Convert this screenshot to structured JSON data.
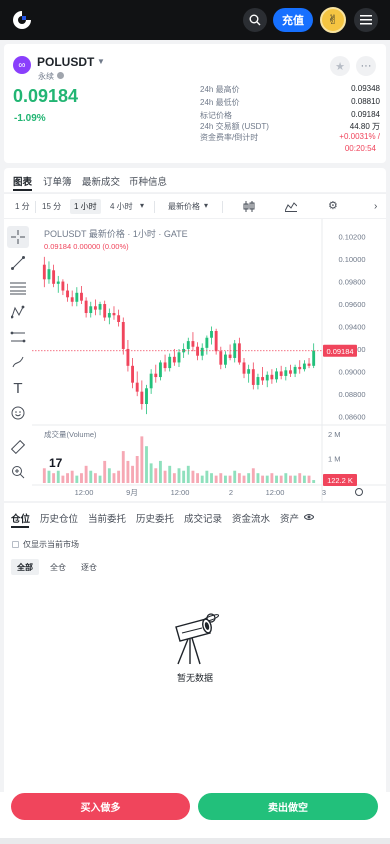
{
  "topbar": {
    "deposit_label": "充值",
    "icons": [
      "logo-icon",
      "search-icon",
      "avatar",
      "menu-icon"
    ]
  },
  "ticker": {
    "symbol": "POLUSDT",
    "type": "永续",
    "price": "0.09184",
    "change": "-1.09%",
    "stats": [
      {
        "label": "24h 最高价",
        "value": "0.09348"
      },
      {
        "label": "24h 最低价",
        "value": "0.08810"
      },
      {
        "label": "标记价格",
        "value": "0.09184"
      },
      {
        "label": "24h 交易额 (USDT)",
        "value": "44.80 万"
      },
      {
        "label": "资金费率/倒计时",
        "value": "+0.0031% /"
      }
    ],
    "countdown": "00:20:54"
  },
  "tabs": [
    "图表",
    "订单簿",
    "最新成交",
    "币种信息"
  ],
  "timeframes": {
    "items": [
      "1 分",
      "15 分",
      "1 小时",
      "4 小时"
    ],
    "active": "1 小时",
    "price_type": "最新价格"
  },
  "chart": {
    "title": "POLUSDT 最新价格 · 1小时 · GATE",
    "ohlc": "0.09184  0.00000 (0.00%)",
    "volume_label": "成交量(Volume)",
    "current_price_tag": "0.09184",
    "volume_tag": "122.2 K",
    "colors": {
      "up": "#22c07b",
      "down": "#f0455c"
    }
  },
  "chart_data": {
    "type": "candlestick",
    "title": "POLUSDT 最新价格 · 1小时 · GATE",
    "yticks": [
      "0.10200",
      "0.10000",
      "0.09800",
      "0.09600",
      "0.09400",
      "0.09200",
      "0.09000",
      "0.08800",
      "0.08600"
    ],
    "ylim": [
      0.0855,
      0.1025
    ],
    "volume_yticks": [
      "2 M",
      "1 M"
    ],
    "xticks": [
      "12:00",
      "9月",
      "12:00",
      "2",
      "12:00",
      "3"
    ],
    "current_price": 0.09184,
    "last_volume": "122.2 K",
    "candles": [
      {
        "o": 0.0995,
        "h": 0.1002,
        "l": 0.0975,
        "c": 0.0982
      },
      {
        "o": 0.0982,
        "h": 0.0998,
        "l": 0.0978,
        "c": 0.0991
      },
      {
        "o": 0.099,
        "h": 0.0995,
        "l": 0.0975,
        "c": 0.0978
      },
      {
        "o": 0.0978,
        "h": 0.0985,
        "l": 0.097,
        "c": 0.098
      },
      {
        "o": 0.098,
        "h": 0.0982,
        "l": 0.0968,
        "c": 0.0972
      },
      {
        "o": 0.0972,
        "h": 0.0978,
        "l": 0.0962,
        "c": 0.0966
      },
      {
        "o": 0.0966,
        "h": 0.0972,
        "l": 0.0958,
        "c": 0.0962
      },
      {
        "o": 0.0962,
        "h": 0.0975,
        "l": 0.0958,
        "c": 0.097
      },
      {
        "o": 0.097,
        "h": 0.0976,
        "l": 0.096,
        "c": 0.0963
      },
      {
        "o": 0.0963,
        "h": 0.0966,
        "l": 0.0948,
        "c": 0.0952
      },
      {
        "o": 0.0952,
        "h": 0.0962,
        "l": 0.0948,
        "c": 0.0958
      },
      {
        "o": 0.0958,
        "h": 0.0964,
        "l": 0.095,
        "c": 0.0955
      },
      {
        "o": 0.0955,
        "h": 0.0962,
        "l": 0.095,
        "c": 0.096
      },
      {
        "o": 0.096,
        "h": 0.0963,
        "l": 0.0945,
        "c": 0.0948
      },
      {
        "o": 0.0948,
        "h": 0.0956,
        "l": 0.0942,
        "c": 0.0952
      },
      {
        "o": 0.0952,
        "h": 0.0958,
        "l": 0.0946,
        "c": 0.095
      },
      {
        "o": 0.095,
        "h": 0.0955,
        "l": 0.094,
        "c": 0.0944
      },
      {
        "o": 0.0944,
        "h": 0.0948,
        "l": 0.0915,
        "c": 0.092
      },
      {
        "o": 0.092,
        "h": 0.0928,
        "l": 0.09,
        "c": 0.0905
      },
      {
        "o": 0.0905,
        "h": 0.0912,
        "l": 0.0885,
        "c": 0.089
      },
      {
        "o": 0.089,
        "h": 0.09,
        "l": 0.0878,
        "c": 0.0882
      },
      {
        "o": 0.0882,
        "h": 0.0892,
        "l": 0.0866,
        "c": 0.0871
      },
      {
        "o": 0.0871,
        "h": 0.0888,
        "l": 0.0862,
        "c": 0.0885
      },
      {
        "o": 0.0885,
        "h": 0.0902,
        "l": 0.088,
        "c": 0.0898
      },
      {
        "o": 0.0898,
        "h": 0.0906,
        "l": 0.089,
        "c": 0.0895
      },
      {
        "o": 0.0895,
        "h": 0.091,
        "l": 0.0892,
        "c": 0.0908
      },
      {
        "o": 0.0908,
        "h": 0.0915,
        "l": 0.09,
        "c": 0.0903
      },
      {
        "o": 0.0903,
        "h": 0.0916,
        "l": 0.09,
        "c": 0.0913
      },
      {
        "o": 0.0913,
        "h": 0.092,
        "l": 0.0905,
        "c": 0.0908
      },
      {
        "o": 0.0908,
        "h": 0.092,
        "l": 0.0904,
        "c": 0.0917
      },
      {
        "o": 0.0917,
        "h": 0.0925,
        "l": 0.0912,
        "c": 0.092
      },
      {
        "o": 0.092,
        "h": 0.093,
        "l": 0.0915,
        "c": 0.0927
      },
      {
        "o": 0.0927,
        "h": 0.0935,
        "l": 0.0918,
        "c": 0.0922
      },
      {
        "o": 0.0922,
        "h": 0.0926,
        "l": 0.091,
        "c": 0.0914
      },
      {
        "o": 0.0914,
        "h": 0.0925,
        "l": 0.091,
        "c": 0.0921
      },
      {
        "o": 0.0921,
        "h": 0.0932,
        "l": 0.0915,
        "c": 0.093
      },
      {
        "o": 0.093,
        "h": 0.094,
        "l": 0.0924,
        "c": 0.0936
      },
      {
        "o": 0.0936,
        "h": 0.0938,
        "l": 0.0915,
        "c": 0.0918
      },
      {
        "o": 0.0918,
        "h": 0.0922,
        "l": 0.0902,
        "c": 0.0906
      },
      {
        "o": 0.0906,
        "h": 0.0918,
        "l": 0.0903,
        "c": 0.0915
      },
      {
        "o": 0.0915,
        "h": 0.0924,
        "l": 0.091,
        "c": 0.0912
      },
      {
        "o": 0.0912,
        "h": 0.0928,
        "l": 0.0908,
        "c": 0.0925
      },
      {
        "o": 0.0925,
        "h": 0.093,
        "l": 0.0906,
        "c": 0.0908
      },
      {
        "o": 0.0908,
        "h": 0.0912,
        "l": 0.0894,
        "c": 0.0898
      },
      {
        "o": 0.0898,
        "h": 0.0906,
        "l": 0.089,
        "c": 0.0902
      },
      {
        "o": 0.0902,
        "h": 0.0908,
        "l": 0.0884,
        "c": 0.0888
      },
      {
        "o": 0.0888,
        "h": 0.0898,
        "l": 0.0884,
        "c": 0.0895
      },
      {
        "o": 0.0895,
        "h": 0.0904,
        "l": 0.0888,
        "c": 0.0892
      },
      {
        "o": 0.0892,
        "h": 0.09,
        "l": 0.0886,
        "c": 0.0897
      },
      {
        "o": 0.0897,
        "h": 0.0902,
        "l": 0.0889,
        "c": 0.0893
      },
      {
        "o": 0.0893,
        "h": 0.0903,
        "l": 0.089,
        "c": 0.09
      },
      {
        "o": 0.09,
        "h": 0.0905,
        "l": 0.0893,
        "c": 0.0896
      },
      {
        "o": 0.0896,
        "h": 0.0904,
        "l": 0.0892,
        "c": 0.0901
      },
      {
        "o": 0.0901,
        "h": 0.0906,
        "l": 0.0895,
        "c": 0.0898
      },
      {
        "o": 0.0898,
        "h": 0.0906,
        "l": 0.0895,
        "c": 0.0904
      },
      {
        "o": 0.0904,
        "h": 0.091,
        "l": 0.0898,
        "c": 0.0902
      },
      {
        "o": 0.0902,
        "h": 0.091,
        "l": 0.09,
        "c": 0.0907
      },
      {
        "o": 0.0907,
        "h": 0.0912,
        "l": 0.0903,
        "c": 0.0905
      },
      {
        "o": 0.0905,
        "h": 0.0925,
        "l": 0.0903,
        "c": 0.09184
      }
    ],
    "volumes": [
      0.6,
      0.5,
      0.4,
      0.5,
      0.3,
      0.4,
      0.5,
      0.3,
      0.4,
      0.7,
      0.5,
      0.4,
      0.3,
      0.9,
      0.6,
      0.4,
      0.5,
      1.3,
      0.9,
      0.7,
      1.1,
      1.9,
      1.5,
      0.8,
      0.6,
      0.9,
      0.5,
      0.7,
      0.4,
      0.6,
      0.5,
      0.7,
      0.5,
      0.4,
      0.3,
      0.5,
      0.4,
      0.3,
      0.4,
      0.3,
      0.3,
      0.5,
      0.4,
      0.3,
      0.4,
      0.6,
      0.4,
      0.3,
      0.3,
      0.4,
      0.3,
      0.3,
      0.4,
      0.3,
      0.3,
      0.4,
      0.3,
      0.3,
      0.12
    ]
  },
  "positions": {
    "tabs": [
      "仓位",
      "历史仓位",
      "当前委托",
      "历史委托",
      "成交记录",
      "资金流水",
      "资产"
    ],
    "only_current_label": "仅显示当前市场",
    "filters": [
      "全部",
      "全仓",
      "逐仓"
    ],
    "empty_text": "暂无数据"
  },
  "actions": {
    "buy_label": "买入做多",
    "sell_label": "卖出做空"
  }
}
